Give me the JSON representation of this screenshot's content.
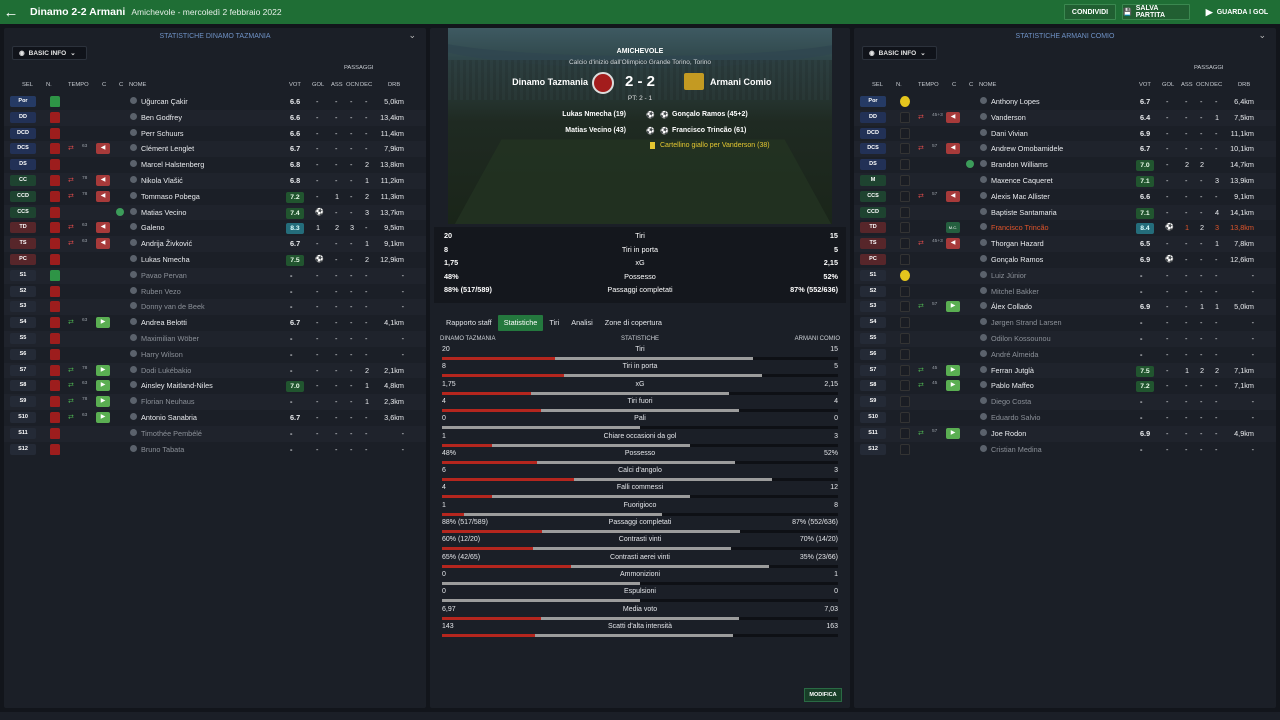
{
  "header": {
    "title": "Dinamo 2-2 Armani",
    "subtitle": "Amichevole - mercoledì 2 febbraio 2022",
    "share": "CONDIVIDI",
    "save": "SALVA PARTITA",
    "goals": "GUARDA I GOL"
  },
  "left": {
    "title": "STATISTICHE DINAMO TAZMANIA",
    "dropdown": "BASIC INFO"
  },
  "right": {
    "title": "STATISTICHE ARMANI COMIO",
    "dropdown": "BASIC INFO"
  },
  "cols": {
    "sel": "SEL",
    "n": "N.",
    "tempo": "TEMPO",
    "c1": "C",
    "c2": "C",
    "nome": "NOME",
    "passaggi": "PASSAGGI",
    "vot": "VOT",
    "gol": "GOL",
    "ass": "ASS",
    "ocn": "OCN",
    "dec": "DEC",
    "drb": "DRB"
  },
  "home_players": [
    {
      "pos": "Por",
      "name": "Uğurcan Çakir",
      "rating": "6.6",
      "gol": "-",
      "ass": "-",
      "ocn": "-",
      "dec": "-",
      "drb": "5,0km"
    },
    {
      "pos": "DD",
      "name": "Ben Godfrey",
      "rating": "6.6",
      "gol": "-",
      "ass": "-",
      "ocn": "-",
      "dec": "-",
      "drb": "13,4km"
    },
    {
      "pos": "DCD",
      "name": "Perr Schuurs",
      "rating": "6.6",
      "gol": "-",
      "ass": "-",
      "ocn": "-",
      "dec": "-",
      "drb": "11,4km"
    },
    {
      "pos": "DCS",
      "name": "Clément Lenglet",
      "rating": "6.7",
      "gol": "-",
      "ass": "-",
      "ocn": "-",
      "dec": "-",
      "drb": "7,9km",
      "subtime": "63"
    },
    {
      "pos": "DS",
      "name": "Marcel Halstenberg",
      "rating": "6.8",
      "gol": "-",
      "ass": "-",
      "ocn": "-",
      "dec": "2",
      "drb": "13,8km"
    },
    {
      "pos": "CC",
      "name": "Nikola Vlašić",
      "rating": "6.8",
      "gol": "-",
      "ass": "-",
      "ocn": "-",
      "dec": "1",
      "drb": "11,2km",
      "subtime": "78"
    },
    {
      "pos": "CCD",
      "name": "Tommaso Pobega",
      "rating": "7.2",
      "gol": "-",
      "ass": "1",
      "ocn": "-",
      "dec": "2",
      "drb": "11,3km",
      "subtime": "78"
    },
    {
      "pos": "CCS",
      "name": "Matias Vecino",
      "rating": "7.4",
      "gol": "",
      "ass": "-",
      "ocn": "-",
      "dec": "3",
      "drb": "13,7km"
    },
    {
      "pos": "TD",
      "name": "Galeno",
      "rating": "8.3",
      "gol": "1",
      "ass": "2",
      "ocn": "3",
      "dec": "-",
      "drb": "9,5km",
      "subtime": "63"
    },
    {
      "pos": "TS",
      "name": "Andrija Živković",
      "rating": "6.7",
      "gol": "-",
      "ass": "-",
      "ocn": "-",
      "dec": "1",
      "drb": "9,1km",
      "subtime": "63"
    },
    {
      "pos": "PC",
      "name": "Lukas Nmecha",
      "rating": "7.5",
      "gol": "",
      "ass": "-",
      "ocn": "-",
      "dec": "2",
      "drb": "12,9km"
    },
    {
      "pos": "S1",
      "name": "Pavao Pervan",
      "rating": "-",
      "gol": "-",
      "ass": "-",
      "ocn": "-",
      "dec": "-",
      "drb": "-"
    },
    {
      "pos": "S2",
      "name": "Ruben Vezo",
      "rating": "-",
      "gol": "-",
      "ass": "-",
      "ocn": "-",
      "dec": "-",
      "drb": "-"
    },
    {
      "pos": "S3",
      "name": "Donny van de Beek",
      "rating": "-",
      "gol": "-",
      "ass": "-",
      "ocn": "-",
      "dec": "-",
      "drb": "-"
    },
    {
      "pos": "S4",
      "name": "Andrea Belotti",
      "rating": "6.7",
      "gol": "-",
      "ass": "-",
      "ocn": "-",
      "dec": "-",
      "drb": "4,1km",
      "subtime": "63"
    },
    {
      "pos": "S5",
      "name": "Maximilian Wöber",
      "rating": "-",
      "gol": "-",
      "ass": "-",
      "ocn": "-",
      "dec": "-",
      "drb": "-"
    },
    {
      "pos": "S6",
      "name": "Harry Wilson",
      "rating": "-",
      "gol": "-",
      "ass": "-",
      "ocn": "-",
      "dec": "-",
      "drb": "-"
    },
    {
      "pos": "S7",
      "name": "Dodi Lukébakio",
      "rating": "-",
      "gol": "-",
      "ass": "-",
      "ocn": "-",
      "dec": "2",
      "drb": "2,1km",
      "subtime": "78"
    },
    {
      "pos": "S8",
      "name": "Ainsley Maitland-Niles",
      "rating": "7.0",
      "gol": "-",
      "ass": "-",
      "ocn": "-",
      "dec": "1",
      "drb": "4,8km",
      "subtime": "63"
    },
    {
      "pos": "S9",
      "name": "Florian Neuhaus",
      "rating": "-",
      "gol": "-",
      "ass": "-",
      "ocn": "-",
      "dec": "1",
      "drb": "2,3km",
      "subtime": "78"
    },
    {
      "pos": "S10",
      "name": "Antonio Sanabria",
      "rating": "6.7",
      "gol": "-",
      "ass": "-",
      "ocn": "-",
      "dec": "-",
      "drb": "3,6km",
      "subtime": "63"
    },
    {
      "pos": "S11",
      "name": "Timothée Pembélé",
      "rating": "-",
      "gol": "-",
      "ass": "-",
      "ocn": "-",
      "dec": "-",
      "drb": "-"
    },
    {
      "pos": "S12",
      "name": "Bruno Tabata",
      "rating": "-",
      "gol": "-",
      "ass": "-",
      "ocn": "-",
      "dec": "-",
      "drb": "-"
    }
  ],
  "away_players": [
    {
      "pos": "Por",
      "name": "Anthony Lopes",
      "rating": "6.7",
      "gol": "-",
      "ass": "-",
      "ocn": "-",
      "dec": "-",
      "drb": "6,4km"
    },
    {
      "pos": "DD",
      "name": "Vanderson",
      "rating": "6.4",
      "gol": "-",
      "ass": "-",
      "ocn": "-",
      "dec": "1",
      "drb": "7,5km",
      "subtime": "45+3"
    },
    {
      "pos": "DCD",
      "name": "Dani Vivian",
      "rating": "6.9",
      "gol": "-",
      "ass": "-",
      "ocn": "-",
      "dec": "-",
      "drb": "11,1km"
    },
    {
      "pos": "DCS",
      "name": "Andrew Omobamidele",
      "rating": "6.7",
      "gol": "-",
      "ass": "-",
      "ocn": "-",
      "dec": "-",
      "drb": "10,1km",
      "subtime": "57"
    },
    {
      "pos": "DS",
      "name": "Brandon Williams",
      "rating": "7.0",
      "gol": "-",
      "ass": "2",
      "ocn": "2",
      "dec": "",
      "drb": "14,7km"
    },
    {
      "pos": "M",
      "name": "Maxence Caqueret",
      "rating": "7.1",
      "gol": "-",
      "ass": "-",
      "ocn": "-",
      "dec": "3",
      "drb": "13,9km"
    },
    {
      "pos": "CCS",
      "name": "Alexis Mac Allister",
      "rating": "6.6",
      "gol": "-",
      "ass": "-",
      "ocn": "-",
      "dec": "-",
      "drb": "9,1km",
      "subtime": "57"
    },
    {
      "pos": "CCD",
      "name": "Baptiste Santamaria",
      "rating": "7.1",
      "gol": "-",
      "ass": "-",
      "ocn": "-",
      "dec": "4",
      "drb": "14,1km"
    },
    {
      "pos": "TD",
      "name": "Francisco Trincão",
      "rating": "8.4",
      "gol": "",
      "ass": "1",
      "ocn": "2",
      "dec": "3",
      "drb": "13,8km",
      "mc": "M.C."
    },
    {
      "pos": "TS",
      "name": "Thorgan Hazard",
      "rating": "6.5",
      "gol": "-",
      "ass": "-",
      "ocn": "-",
      "dec": "1",
      "drb": "7,8km",
      "subtime": "45+3"
    },
    {
      "pos": "PC",
      "name": "Gonçalo Ramos",
      "rating": "6.9",
      "gol": "",
      "ass": "-",
      "ocn": "-",
      "dec": "-",
      "drb": "12,6km"
    },
    {
      "pos": "S1",
      "name": "Luiz Júnior",
      "rating": "-",
      "gol": "-",
      "ass": "-",
      "ocn": "-",
      "dec": "-",
      "drb": "-"
    },
    {
      "pos": "S2",
      "name": "Mitchel Bakker",
      "rating": "-",
      "gol": "-",
      "ass": "-",
      "ocn": "-",
      "dec": "-",
      "drb": "-"
    },
    {
      "pos": "S3",
      "name": "Álex Collado",
      "rating": "6.9",
      "gol": "-",
      "ass": "-",
      "ocn": "1",
      "dec": "1",
      "drb": "5,0km",
      "subtime": "57"
    },
    {
      "pos": "S4",
      "name": "Jørgen Strand Larsen",
      "rating": "-",
      "gol": "-",
      "ass": "-",
      "ocn": "-",
      "dec": "-",
      "drb": "-"
    },
    {
      "pos": "S5",
      "name": "Odilon Kossounou",
      "rating": "-",
      "gol": "-",
      "ass": "-",
      "ocn": "-",
      "dec": "-",
      "drb": "-"
    },
    {
      "pos": "S6",
      "name": "André Almeida",
      "rating": "-",
      "gol": "-",
      "ass": "-",
      "ocn": "-",
      "dec": "-",
      "drb": "-"
    },
    {
      "pos": "S7",
      "name": "Ferran Jutglà",
      "rating": "7.5",
      "gol": "-",
      "ass": "1",
      "ocn": "2",
      "dec": "2",
      "drb": "7,1km",
      "subtime": "45"
    },
    {
      "pos": "S8",
      "name": "Pablo Maffeo",
      "rating": "7.2",
      "gol": "-",
      "ass": "-",
      "ocn": "-",
      "dec": "-",
      "drb": "7,1km",
      "subtime": "45"
    },
    {
      "pos": "S9",
      "name": "Diego Costa",
      "rating": "-",
      "gol": "-",
      "ass": "-",
      "ocn": "-",
      "dec": "-",
      "drb": "-"
    },
    {
      "pos": "S10",
      "name": "Eduardo Salvio",
      "rating": "-",
      "gol": "-",
      "ass": "-",
      "ocn": "-",
      "dec": "-",
      "drb": "-"
    },
    {
      "pos": "S11",
      "name": "Joe Rodon",
      "rating": "6.9",
      "gol": "-",
      "ass": "-",
      "ocn": "-",
      "dec": "-",
      "drb": "4,9km",
      "subtime": "57"
    },
    {
      "pos": "S12",
      "name": "Cristian Medina",
      "rating": "-",
      "gol": "-",
      "ass": "-",
      "ocn": "-",
      "dec": "-",
      "drb": "-"
    }
  ],
  "match": {
    "competition": "AMICHEVOLE",
    "venue": "Calcio d'inizio dall'Olimpico Grande Torino, Torino",
    "home": "Dinamo Tazmania",
    "away": "Armani Comio",
    "score": "2 - 2",
    "ht": "PT: 2 - 1",
    "scorers_home": [
      "Lukas Nmecha (19)",
      "Matias Vecino (43)"
    ],
    "scorers_away": [
      "Gonçalo Ramos (45+2)",
      "Francisco Trincão (61)"
    ],
    "card": "Cartellino giallo per Vanderson (38)"
  },
  "summary": [
    {
      "h": "20",
      "label": "Tiri",
      "a": "15"
    },
    {
      "h": "8",
      "label": "Tiri in porta",
      "a": "5"
    },
    {
      "h": "1,75",
      "label": "xG",
      "a": "2,15"
    },
    {
      "h": "48%",
      "label": "Possesso",
      "a": "52%"
    },
    {
      "h": "88% (517/589)",
      "label": "Passaggi completati",
      "a": "87% (552/636)"
    }
  ],
  "tabs": [
    "Rapporto staff",
    "Statistiche",
    "Tiri",
    "Analisi",
    "Zone di copertura"
  ],
  "statsheader": {
    "home": "DINAMO TAZMANIA",
    "mid": "STATISTICHE",
    "away": "ARMANI COMIO"
  },
  "stats": [
    {
      "h": "20",
      "label": "Tiri",
      "a": "15",
      "hv": 20,
      "av": 15
    },
    {
      "h": "8",
      "label": "Tiri in porta",
      "a": "5",
      "hv": 8,
      "av": 5
    },
    {
      "h": "1,75",
      "label": "xG",
      "a": "2,15",
      "hv": 1.75,
      "av": 2.15
    },
    {
      "h": "4",
      "label": "Tiri fuori",
      "a": "4",
      "hv": 4,
      "av": 4
    },
    {
      "h": "0",
      "label": "Pali",
      "a": "0",
      "hv": 0,
      "av": 0
    },
    {
      "h": "1",
      "label": "Chiare occasioni da gol",
      "a": "3",
      "hv": 1,
      "av": 3
    },
    {
      "h": "48%",
      "label": "Possesso",
      "a": "52%",
      "hv": 48,
      "av": 52
    },
    {
      "h": "6",
      "label": "Calci d'angolo",
      "a": "3",
      "hv": 6,
      "av": 3
    },
    {
      "h": "4",
      "label": "Falli commessi",
      "a": "12",
      "hv": 4,
      "av": 12
    },
    {
      "h": "1",
      "label": "Fuorigioco",
      "a": "8",
      "hv": 1,
      "av": 8
    },
    {
      "h": "88% (517/589)",
      "label": "Passaggi completati",
      "a": "87% (552/636)",
      "hv": 88,
      "av": 87
    },
    {
      "h": "60% (12/20)",
      "label": "Contrasti vinti",
      "a": "70% (14/20)",
      "hv": 60,
      "av": 70
    },
    {
      "h": "65% (42/65)",
      "label": "Contrasti aerei vinti",
      "a": "35% (23/66)",
      "hv": 65,
      "av": 35
    },
    {
      "h": "0",
      "label": "Ammonizioni",
      "a": "1",
      "hv": 0,
      "av": 1
    },
    {
      "h": "0",
      "label": "Espulsioni",
      "a": "0",
      "hv": 0,
      "av": 0
    },
    {
      "h": "6,97",
      "label": "Media voto",
      "a": "7,03",
      "hv": 6.97,
      "av": 7.03
    },
    {
      "h": "143",
      "label": "Scatti d'alta intensità",
      "a": "163",
      "hv": 143,
      "av": 163
    }
  ],
  "modifica": "MODIFICA"
}
